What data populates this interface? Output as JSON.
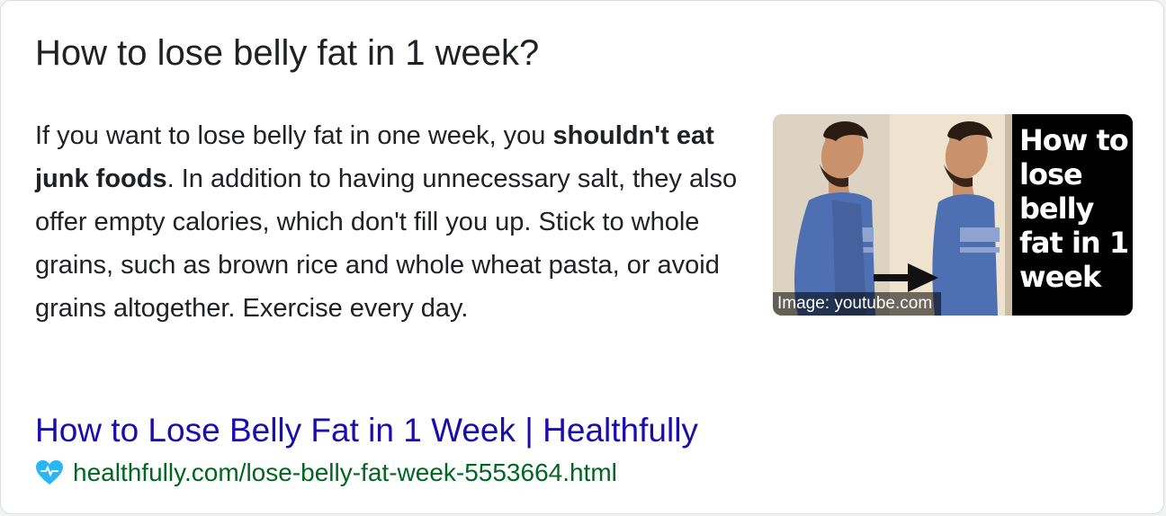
{
  "featured_snippet": {
    "question": "How to lose belly fat in 1 week?",
    "answer_parts": [
      "If you want to lose belly fat in one week, you ",
      "shouldn't eat junk foods",
      ". In addition to having unnecessary salt, they also offer empty calories, which don't fill you up. Stick to whole grains, such as brown rice and whole wheat pasta, or avoid grains altogether. Exercise every day."
    ],
    "image": {
      "overlay_text": "How to lose belly fat in 1 week",
      "credit": "Image: youtube.com"
    },
    "result": {
      "title": "How to Lose Belly Fat in 1 Week | Healthfully",
      "url": "healthfully.com/lose-belly-fat-week-5553664.html",
      "favicon": "heart-icon"
    }
  },
  "colors": {
    "link": "#1a0dab",
    "url": "#006621",
    "text": "#202124",
    "favicon": "#29b6f6"
  }
}
